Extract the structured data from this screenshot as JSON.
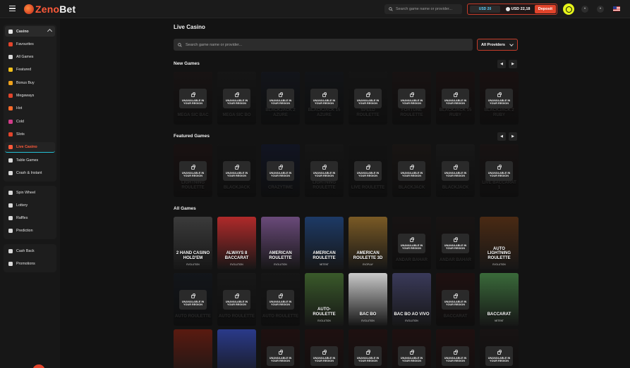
{
  "header": {
    "logo_left": "Zeno",
    "logo_right": "Bet",
    "search_placeholder": "Search game name or provider...",
    "balance_bonus": "USD 20",
    "balance_main": "USD 22,18",
    "deposit_label": "Deposit"
  },
  "sidebar": {
    "groups": [
      {
        "items": [
          {
            "label": "Casino",
            "icon": "casino-icon",
            "color": "#e8e8e8",
            "header": true
          },
          {
            "label": "Favourites",
            "icon": "heart-icon",
            "color": "#e2442b"
          },
          {
            "label": "All Games",
            "icon": "gamepad-icon",
            "color": "#d9d9d9"
          },
          {
            "label": "Featured",
            "icon": "star-icon",
            "color": "#f3c11b"
          },
          {
            "label": "Bonus Buy",
            "icon": "coin-icon",
            "color": "#f0a21b"
          },
          {
            "label": "Megaways",
            "icon": "megaways-icon",
            "color": "#e2442b"
          },
          {
            "label": "Hot",
            "icon": "fire-icon",
            "color": "#ff6b2b"
          },
          {
            "label": "Cold",
            "icon": "snowflake-icon",
            "color": "#d23c8a"
          },
          {
            "label": "Slots",
            "icon": "slots-icon",
            "color": "#e2442b"
          },
          {
            "label": "Live Casino",
            "icon": "live-icon",
            "color": "#ff5a3a",
            "active": true
          },
          {
            "label": "Table Games",
            "icon": "table-icon",
            "color": "#d9d9d9"
          },
          {
            "label": "Crash & Instant",
            "icon": "crash-icon",
            "color": "#d9d9d9"
          }
        ]
      },
      {
        "items": [
          {
            "label": "Spin Wheel",
            "icon": "wheel-icon",
            "color": "#d9d9d9"
          },
          {
            "label": "Lottery",
            "icon": "lottery-icon",
            "color": "#d9d9d9"
          },
          {
            "label": "Raffles",
            "icon": "raffle-icon",
            "color": "#d9d9d9"
          },
          {
            "label": "Prediction",
            "icon": "prediction-icon",
            "color": "#d9d9d9"
          }
        ]
      },
      {
        "items": [
          {
            "label": "Cash Back",
            "icon": "cashback-icon",
            "color": "#d9d9d9"
          },
          {
            "label": "Promotions",
            "icon": "promo-icon",
            "color": "#d9d9d9"
          }
        ]
      }
    ]
  },
  "main": {
    "title": "Live Casino",
    "search_placeholder": "Search game name or provider...",
    "providers_label": "All Providers",
    "unavailable_line1": "UNAVAILABLE IN",
    "unavailable_line2": "YOUR REGION",
    "sections": [
      {
        "title": "New Games",
        "arrows": true,
        "rows": [
          [
            {
              "name": "MEGA SIC BAC",
              "locked": true,
              "bg": "#2a2020"
            },
            {
              "name": "MEGA SIC BO",
              "locked": true,
              "bg": "#262626"
            },
            {
              "name": "BLACKJACK 2 AZURE",
              "locked": true,
              "bg": "#1f2430"
            },
            {
              "name": "BLACKJACK 15 AZURE",
              "locked": true,
              "bg": "#1e2229"
            },
            {
              "name": "SPEED ROULETTE",
              "locked": true,
              "bg": "#232323"
            },
            {
              "name": "FORTUNE ROULETTE",
              "locked": true,
              "bg": "#2a1e1e"
            },
            {
              "name": "BLACKJACK 15 RUBY",
              "locked": true,
              "bg": "#2c1a1a"
            },
            {
              "name": "BLACKJACK 2 RUBY",
              "locked": true,
              "bg": "#2c1a1a"
            }
          ]
        ]
      },
      {
        "title": "Featured Games",
        "arrows": true,
        "rows": [
          [
            {
              "name": "LIGHTNING ROULETTE",
              "locked": true,
              "bg": "#2d1c1c"
            },
            {
              "name": "BLACKJACK",
              "locked": true,
              "bg": "#1f1f1f"
            },
            {
              "name": "CRAZYTIME",
              "locked": true,
              "bg": "#1c2340"
            },
            {
              "name": "LIGHTNING ROULETTE",
              "locked": true,
              "bg": "#262626"
            },
            {
              "name": "LIVE ROULETTE",
              "locked": true,
              "bg": "#1f1f1f"
            },
            {
              "name": "BLACKJACK",
              "locked": true,
              "bg": "#2c2420"
            },
            {
              "name": "BLACKJACK",
              "locked": true,
              "bg": "#2a2a2a"
            },
            {
              "name": "LIVE BACCARAT 1",
              "locked": true,
              "bg": "#2a1f1f"
            }
          ]
        ]
      },
      {
        "title": "All Games",
        "arrows": false,
        "rows": [
          [
            {
              "name": "2 HAND CASINO HOLD'EM",
              "provider": "EVOLUTION",
              "locked": false,
              "bg": "#3b3b3b"
            },
            {
              "name": "ALWAYS 8 BACCARAT",
              "provider": "EVOLUTION",
              "locked": false,
              "bg": "#b02a2a"
            },
            {
              "name": "AMERICAN ROULETTE",
              "provider": "EVOLUTION",
              "locked": false,
              "bg": "#6a4a7a"
            },
            {
              "name": "AMERICAN ROULETTE",
              "provider": "NETENT",
              "locked": false,
              "bg": "#1d3a66"
            },
            {
              "name": "AMERICAN ROULETTE 3D",
              "provider": "EVOPLAY",
              "locked": false,
              "bg": "#7a5a25"
            },
            {
              "name": "ANDAR BAHAR",
              "locked": true,
              "bg": "#2a2020"
            },
            {
              "name": "ANDAR BAHAR",
              "locked": true,
              "bg": "#2a2220"
            },
            {
              "name": "AUTO LIGHTNING ROULETTE",
              "provider": "EVOLUTION",
              "locked": false,
              "bg": "#4a2a14"
            }
          ],
          [
            {
              "name": "AUTO ROULETTE",
              "locked": true,
              "bg": "#1f2630"
            },
            {
              "name": "AUTO ROULETTE",
              "locked": true,
              "bg": "#2a2a2a"
            },
            {
              "name": "AUTO ROULETTE",
              "locked": true,
              "bg": "#262626"
            },
            {
              "name": "AUTO-ROULETTE",
              "provider": "EVOLUTION",
              "locked": false,
              "bg": "#3a5a2a"
            },
            {
              "name": "BAC BO",
              "provider": "EVOLUTION",
              "locked": false,
              "bg": "#c9c9c9"
            },
            {
              "name": "BAC BO AO VIVO",
              "provider": "EVOLUTION",
              "locked": false,
              "bg": "#3a3a5a"
            },
            {
              "name": "BACCARAT",
              "locked": true,
              "bg": "#3a1a1a"
            },
            {
              "name": "BACCARAT",
              "provider": "NETENT",
              "locked": false,
              "bg": "#3a6a3a"
            }
          ],
          [
            {
              "name": "",
              "locked": false,
              "bg": "#5a1a10"
            },
            {
              "name": "",
              "locked": false,
              "bg": "#2a3a8a"
            },
            {
              "name": "",
              "locked": true,
              "bg": "#3a1a1a"
            },
            {
              "name": "",
              "locked": true,
              "bg": "#3a1a1a"
            },
            {
              "name": "",
              "locked": true,
              "bg": "#3a1a1a"
            },
            {
              "name": "",
              "locked": true,
              "bg": "#3a1a1a"
            },
            {
              "name": "",
              "locked": true,
              "bg": "#3a1a1a"
            },
            {
              "name": "",
              "locked": true,
              "bg": "#2a2020"
            }
          ]
        ]
      }
    ]
  }
}
